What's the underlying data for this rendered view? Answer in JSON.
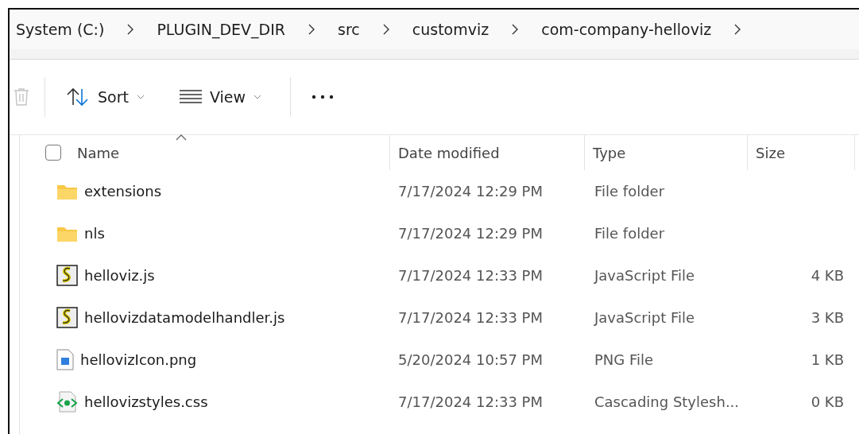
{
  "breadcrumb": [
    "System (C:)",
    "PLUGIN_DEV_DIR",
    "src",
    "customviz",
    "com-company-helloviz"
  ],
  "toolbar": {
    "delete": {
      "disabled": true
    },
    "sort": {
      "label": "Sort"
    },
    "view": {
      "label": "View"
    }
  },
  "table": {
    "columns": [
      {
        "label": "Name",
        "sorted": true
      },
      {
        "label": "Date modified",
        "sorted": false
      },
      {
        "label": "Type",
        "sorted": false
      },
      {
        "label": "Size",
        "sorted": false
      }
    ],
    "select_all": {
      "checked": false
    },
    "rows": [
      {
        "kind": "folder",
        "name": "extensions",
        "date": "7/17/2024 12:29 PM",
        "type": "File folder"
      },
      {
        "kind": "folder",
        "name": "nls",
        "date": "7/17/2024 12:29 PM",
        "type": "File folder"
      },
      {
        "kind": "script",
        "name": "helloviz.js",
        "date": "7/17/2024 12:33 PM",
        "type": "JavaScript File",
        "size": "4 KB"
      },
      {
        "kind": "script",
        "name": "hellovizdatamodelhandler.js",
        "date": "7/17/2024 12:33 PM",
        "type": "JavaScript File",
        "size": "3 KB"
      },
      {
        "kind": "image",
        "name": "hellovizIcon.png",
        "date": "5/20/2024 10:57 PM",
        "type": "PNG File",
        "size": "1 KB"
      },
      {
        "kind": "css",
        "name": "hellovizstyles.css",
        "date": "7/17/2024 12:33 PM",
        "type": "Cascading Stylesh...",
        "size": "0 KB"
      }
    ]
  }
}
